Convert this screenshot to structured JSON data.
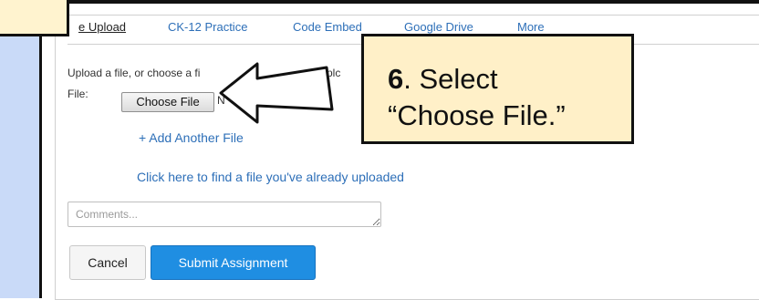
{
  "tabs": [
    "e Upload",
    "CK-12 Practice",
    "Code Embed",
    "Google Drive",
    "More"
  ],
  "instruction": "Upload a file, or choose a fi",
  "instruction_tail": "y uplc",
  "file": {
    "label": "File:",
    "choose_button": "Choose File",
    "trailing_char": "N"
  },
  "add_another": "+ Add Another File",
  "find_file_link": "Click here to find a file you've already uploaded",
  "comments": {
    "placeholder": "Comments..."
  },
  "buttons": {
    "cancel": "Cancel",
    "submit": "Submit Assignment"
  },
  "callout": {
    "step": "6",
    "line1": ". Select",
    "line2": "“Choose File.”"
  },
  "colors": {
    "link": "#2d6fb8",
    "submit": "#1f8ee2",
    "callout_bg": "#fff0c8",
    "left_band": "#c9daf8"
  }
}
